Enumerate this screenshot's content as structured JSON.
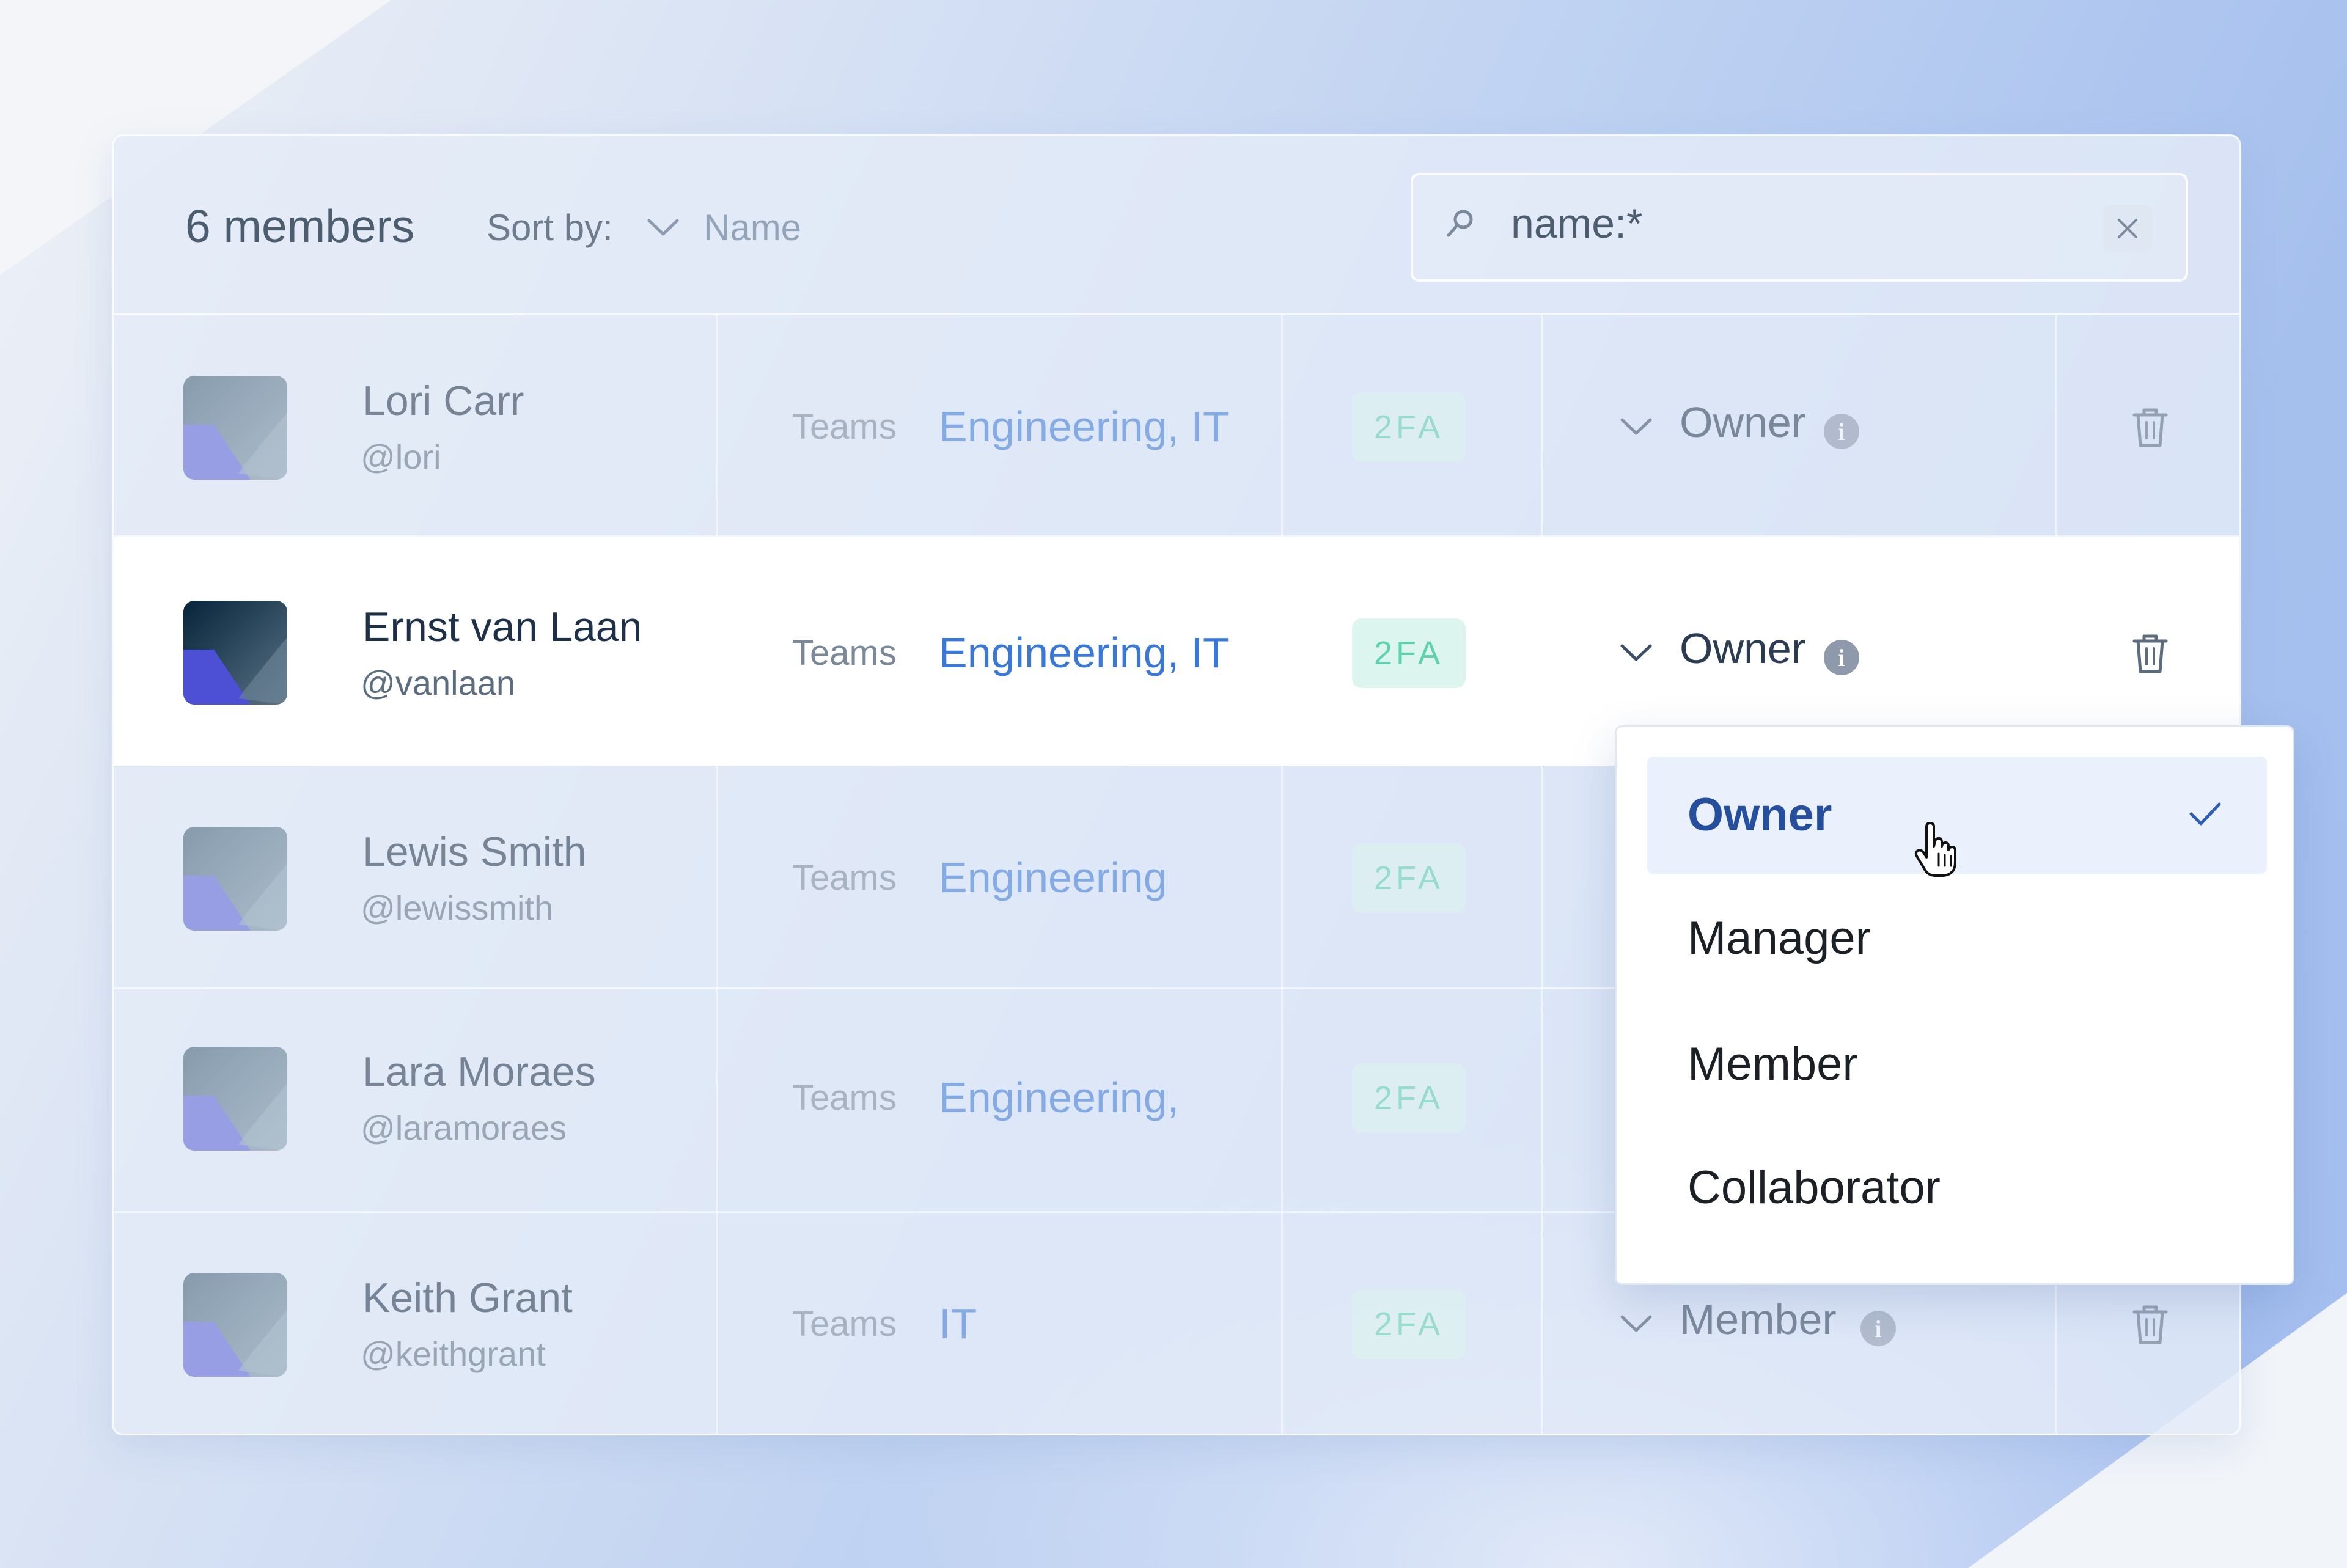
{
  "toolbar": {
    "member_count": "6 members",
    "sort_label": "Sort by:",
    "sort_value": "Name",
    "search_value": "name:*"
  },
  "members": [
    {
      "name": "Lori Carr",
      "handle": "@lori",
      "teams_label": "Teams",
      "teams": "Engineering, IT",
      "badge": "2FA",
      "role": "Owner"
    },
    {
      "name": "Ernst van Laan",
      "handle": "@vanlaan",
      "teams_label": "Teams",
      "teams": "Engineering, IT",
      "badge": "2FA",
      "role": "Owner"
    },
    {
      "name": "Lewis Smith",
      "handle": "@lewissmith",
      "teams_label": "Teams",
      "teams": "Engineering",
      "badge": "2FA",
      "role": ""
    },
    {
      "name": "Lara Moraes",
      "handle": "@laramoraes",
      "teams_label": "Teams",
      "teams": "Engineering,",
      "badge": "2FA",
      "role": ""
    },
    {
      "name": "Keith Grant",
      "handle": "@keithgrant",
      "teams_label": "Teams",
      "teams": "IT",
      "badge": "2FA",
      "role": "Member"
    }
  ],
  "role_dropdown": {
    "options": [
      "Owner",
      "Manager",
      "Member",
      "Collaborator"
    ],
    "selected": "Owner"
  },
  "icons": {
    "search": "search-icon",
    "clear": "close-icon",
    "sort": "chevron-down-icon",
    "role": "chevron-down-icon",
    "info": "info-icon",
    "delete": "trash-icon",
    "check": "check-icon",
    "cursor": "hand-pointer-icon"
  },
  "colors": {
    "accent": "#3a78d8",
    "badge_bg": "#dcf5ef",
    "badge_text": "#5fd2ad",
    "selected_option": "#254e9c"
  }
}
